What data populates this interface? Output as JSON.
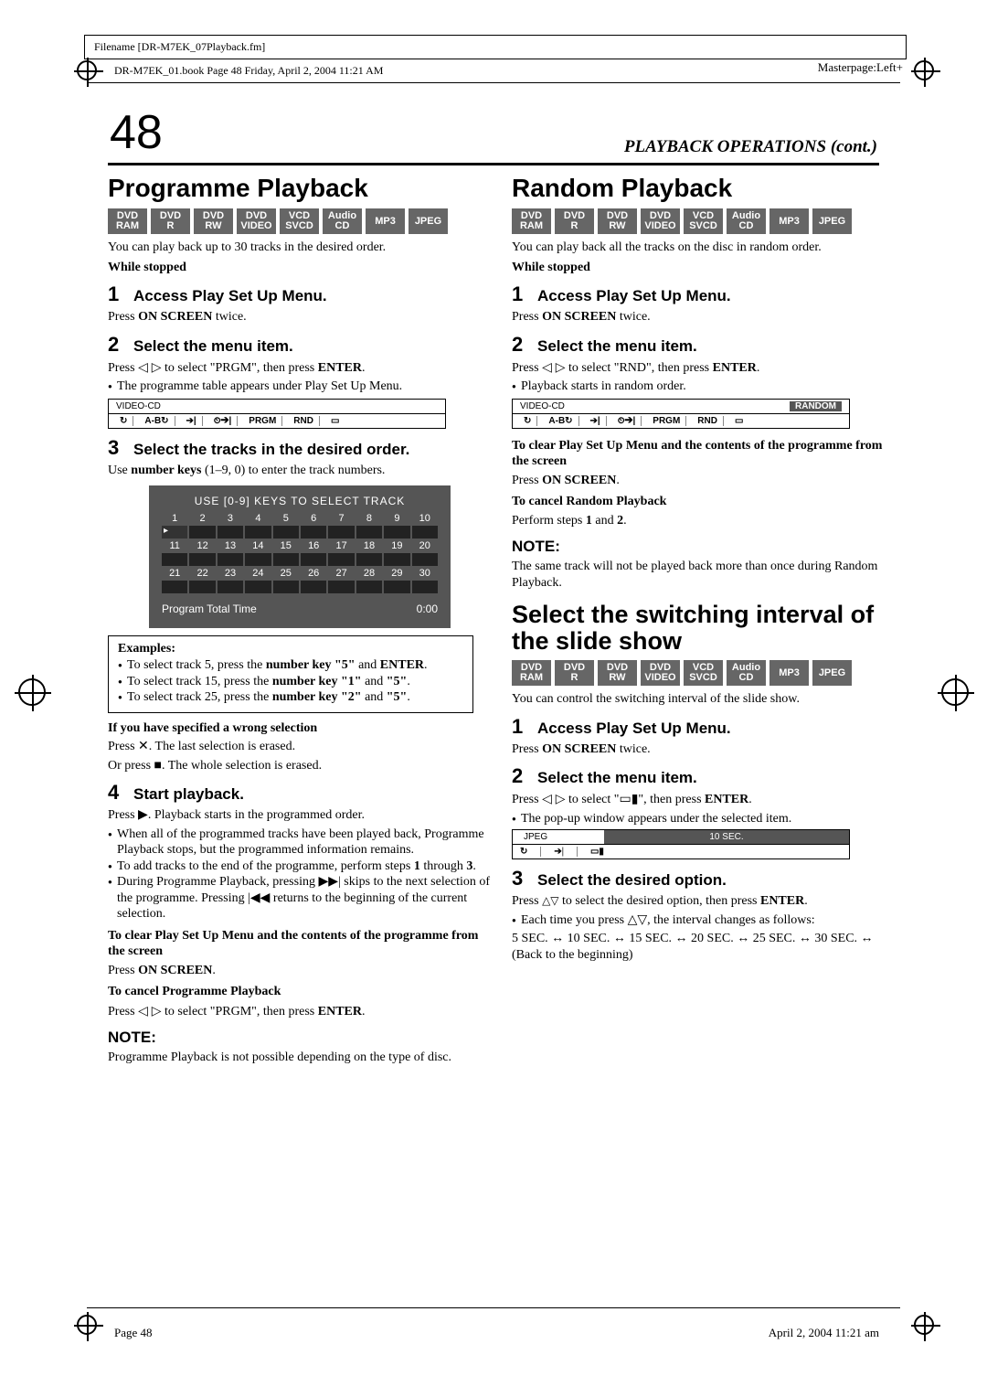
{
  "frame": {
    "filename": "Filename [DR-M7EK_07Playback.fm]"
  },
  "header": {
    "bookinfo": "DR-M7EK_01.book  Page 48  Friday, April 2, 2004  11:21 AM",
    "masterpage": "Masterpage:Left+"
  },
  "page_number": "48",
  "section_title": "PLAYBACK OPERATIONS (cont.)",
  "badges": {
    "dvdram": "DVD RAM",
    "dvdr": "DVD R",
    "dvdrw": "DVD RW",
    "dvdvideo": "DVD VIDEO",
    "vcdsvcd": "VCD SVCD",
    "audiocd": "Audio CD",
    "mp3": "MP3",
    "jpeg": "JPEG"
  },
  "left": {
    "h": "Programme Playback",
    "intro": "You can play back up to 30 tracks in the desired order.",
    "while": "While stopped",
    "s1t": "Access Play Set Up Menu.",
    "s1b_a": "Press ",
    "s1b_b": "ON SCREEN",
    "s1b_c": " twice.",
    "s2t": "Select the menu item.",
    "s2ba": "Press ",
    "s2bb": " to select \"PRGM\", then press ",
    "s2bc": "ENTER",
    "s2bd": ".",
    "s2li": "The programme table appears under Play Set Up Menu.",
    "menubar_title": "VIDEO-CD",
    "mb": [
      "↻",
      "A-B↻",
      "➔|",
      "⏲➔|",
      "PRGM",
      "RND",
      "▭"
    ],
    "s3t": "Select the tracks in the desired order.",
    "s3ba": "Use ",
    "s3bb": "number keys",
    "s3bc": " (1–9, 0) to enter the track numbers.",
    "track_hdr": "USE [0-9] KEYS TO SELECT TRACK",
    "track_ft_l": "Program Total Time",
    "track_ft_r": "0:00",
    "ex_title": "Examples:",
    "ex1a": "To select track 5, press the ",
    "ex1b": "number key \"5\"",
    "ex1c": " and ",
    "ex1d": "ENTER",
    "ex1e": ".",
    "ex2a": "To select track 15, press the ",
    "ex2b": "number key \"1\"",
    "ex2c": " and ",
    "ex2d": "\"5\"",
    "ex2e": ".",
    "ex3a": "To select track 25, press the ",
    "ex3b": "number key \"2\"",
    "ex3c": " and ",
    "ex3d": "\"5\"",
    "ex3e": ".",
    "wrong_h": "If you have specified a wrong selection",
    "wrong1": "Press ✕. The last selection is erased.",
    "wrong2": "Or press ■. The whole selection is erased.",
    "s4t": "Start playback.",
    "s4a": "Press ▶. Playback starts in the programmed order.",
    "s4li1": "When all of the programmed tracks have been played back, Programme Playback stops, but the programmed information remains.",
    "s4li2a": "To add tracks to the end of the programme, perform steps ",
    "s4li2b": "1",
    "s4li2c": " through ",
    "s4li2d": "3",
    "s4li2e": ".",
    "s4li3": "During Programme Playback, pressing ▶▶| skips to the next selection of the programme. Pressing |◀◀ returns to the beginning of the current selection.",
    "clr_h": "To clear Play Set Up Menu and the contents of the programme from the screen",
    "clr_b1": "Press ",
    "clr_b2": "ON SCREEN",
    "clr_b3": ".",
    "cancel_h": "To cancel Programme Playback",
    "cancel_a": "Press ",
    "cancel_b": " to select \"PRGM\", then press ",
    "cancel_c": "ENTER",
    "cancel_d": ".",
    "note_h": "NOTE:",
    "note_b": "Programme Playback is not possible depending on the type of disc."
  },
  "right": {
    "h": "Random Playback",
    "intro": "You can play back all the tracks on the disc in random order.",
    "while": "While stopped",
    "s1t": "Access Play Set Up Menu.",
    "s1a": "Press ",
    "s1b": "ON SCREEN",
    "s1c": " twice.",
    "s2t": "Select the menu item.",
    "s2a": "Press ",
    "s2b": " to select \"RND\", then press ",
    "s2c": "ENTER",
    "s2d": ".",
    "s2li": "Playback starts in random order.",
    "menubar_title": "VIDEO-CD",
    "menubar_tag": "RANDOM",
    "mb": [
      "↻",
      "A-B↻",
      "➔|",
      "⏲➔|",
      "PRGM",
      "RND",
      "▭"
    ],
    "clr_h": "To clear Play Set Up Menu and the contents of the programme from the screen",
    "clr_b1": "Press ",
    "clr_b2": "ON SCREEN",
    "clr_b3": ".",
    "cancel_h": "To cancel Random Playback",
    "cancel_a": "Perform steps ",
    "cancel_b": "1",
    "cancel_c": " and ",
    "cancel_d": "2",
    "cancel_e": ".",
    "note_h": "NOTE:",
    "note_b": "The same track will not be played back more than once during Random Playback.",
    "h2": "Select the switching interval of the slide show",
    "ss_intro": "You can control the switching interval of the slide show.",
    "ss_s1t": "Access Play Set Up Menu.",
    "ss_s1a": "Press ",
    "ss_s1b": "ON SCREEN",
    "ss_s1c": " twice.",
    "ss_s2t": "Select the menu item.",
    "ss_s2a": "Press ",
    "ss_s2b": " to select \"",
    "ss_s2c": "\", then press ",
    "ss_s2d": "ENTER",
    "ss_s2e": ".",
    "ss_s2li": "The pop-up window appears under the selected item.",
    "jpeg_left": "JPEG",
    "jpeg_right": "10 SEC.",
    "jpeg_items": [
      "↻",
      "➔|",
      "▭▮"
    ],
    "ss_s3t": "Select the desired option.",
    "ss_s3a": "Press ",
    "ss_s3b": " to select the desired option, then press ",
    "ss_s3c": "ENTER",
    "ss_s3d": ".",
    "ss_s3li": "Each time you press △▽, the interval changes as follows:",
    "intervals": "5 SEC. ↔ 10 SEC. ↔ 15 SEC. ↔ 20 SEC. ↔ 25 SEC. ↔ 30 SEC. ↔ (Back to the beginning)"
  },
  "footer": {
    "page": "Page 48",
    "date": "April 2, 2004 11:21 am"
  },
  "track_labels": [
    [
      "1",
      "2",
      "3",
      "4",
      "5",
      "6",
      "7",
      "8",
      "9",
      "10"
    ],
    [
      "11",
      "12",
      "13",
      "14",
      "15",
      "16",
      "17",
      "18",
      "19",
      "20"
    ],
    [
      "21",
      "22",
      "23",
      "24",
      "25",
      "26",
      "27",
      "28",
      "29",
      "30"
    ]
  ]
}
